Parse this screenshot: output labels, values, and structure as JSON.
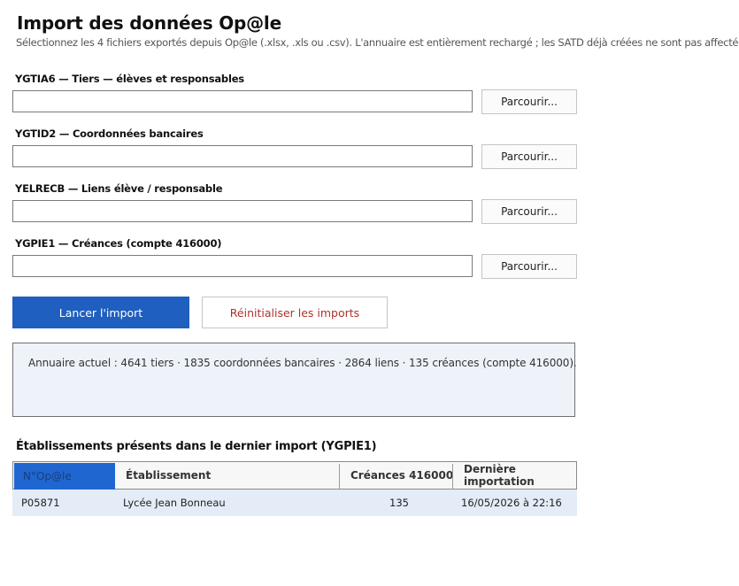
{
  "header": {
    "title": "Import des données Op@le",
    "subtitle": "Sélectionnez les 4 fichiers exportés depuis Op@le (.xlsx, .xls ou .csv). L'annuaire est entièrement rechargé ; les SATD déjà créées ne sont pas affectées."
  },
  "files": [
    {
      "label": "YGTIA6 — Tiers — élèves et responsables",
      "value": "",
      "browse": "Parcourir..."
    },
    {
      "label": "YGTID2 — Coordonnées bancaires",
      "value": "",
      "browse": "Parcourir..."
    },
    {
      "label": "YELRECB — Liens élève / responsable",
      "value": "",
      "browse": "Parcourir..."
    },
    {
      "label": "YGPIE1 — Créances (compte 416000)",
      "value": "",
      "browse": "Parcourir..."
    }
  ],
  "actions": {
    "launch": "Lancer l'import",
    "reset": "Réinitialiser les imports"
  },
  "status": "Annuaire actuel : 4641 tiers · 1835 coordonnées bancaires · 2864 liens · 135 créances (compte 416000).",
  "table": {
    "title": "Établissements présents dans le dernier import (YGPIE1)",
    "columns": [
      "N°Op@le",
      "Établissement",
      "Créances 416000",
      "Dernière importation"
    ],
    "rows": [
      [
        "P05871",
        "Lycée Jean Bonneau",
        "135",
        "16/05/2026 à 22:16"
      ]
    ]
  },
  "colors": {
    "primary": "#1f5fbf",
    "reset_text": "#b0322b",
    "status_bg": "#eef3fa",
    "row_bg": "#e4ecf7",
    "selected_header": "#1f66d1"
  }
}
